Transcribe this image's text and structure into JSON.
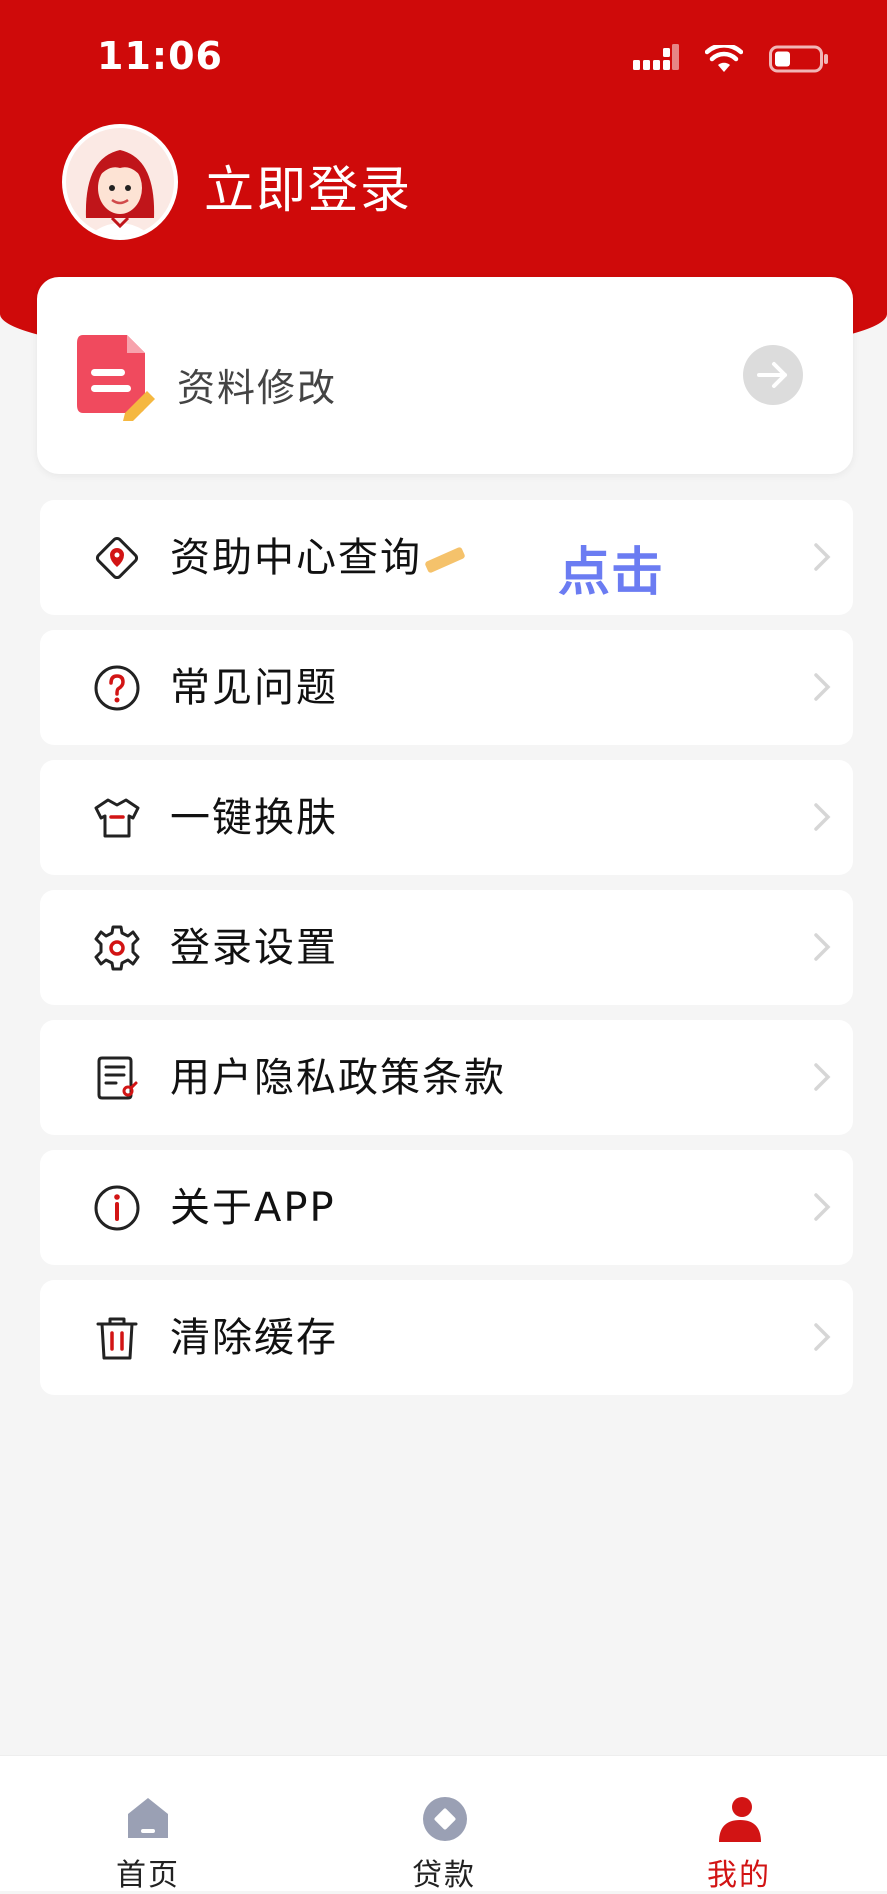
{
  "status_bar": {
    "time": "11:06"
  },
  "header": {
    "login_text": "立即登录"
  },
  "profile_card": {
    "label": "资料修改"
  },
  "menu": [
    {
      "label": "资助中心查询",
      "icon": "location-diamond-icon"
    },
    {
      "label": "常见问题",
      "icon": "question-circle-icon"
    },
    {
      "label": "一键换肤",
      "icon": "shirt-icon"
    },
    {
      "label": "登录设置",
      "icon": "gear-icon"
    },
    {
      "label": "用户隐私政策条款",
      "icon": "document-icon"
    },
    {
      "label": "关于APP",
      "icon": "info-circle-icon"
    },
    {
      "label": "清除缓存",
      "icon": "trash-icon"
    }
  ],
  "click_hint": "点击",
  "tabs": [
    {
      "label": "首页",
      "icon": "home-icon",
      "active": false
    },
    {
      "label": "贷款",
      "icon": "loan-icon",
      "active": false
    },
    {
      "label": "我的",
      "icon": "person-icon",
      "active": true
    }
  ],
  "colors": {
    "brand_red": "#cf0a0a",
    "active_tab": "#d21414",
    "hint_blue": "#6b7cf2"
  }
}
